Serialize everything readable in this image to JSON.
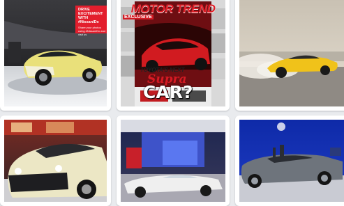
{
  "gallery": {
    "tiles": [
      {
        "alt": "Yellow concept car at auto show",
        "billboard_line1": "DRIVE EXCITEMENT",
        "billboard_line2": "WITH #NissanIDx",
        "billboard_small": "Share your photos using #NissanIDx and visit us"
      },
      {
        "alt": "Motor Trend magazine cover",
        "mag_title": "MOTOR TREND",
        "mag_exclusive": "EXCLUSIVE",
        "mag_headline": "TOYOTA'S NEXT",
        "mag_super": "Supra",
        "mag_car": "CAR?"
      },
      {
        "alt": "Yellow Corvette drifting with tire smoke"
      },
      {
        "alt": "Cream and black retro concept car on display"
      },
      {
        "alt": "White vintage concept roadster in showroom"
      },
      {
        "alt": "Gray convertible Mustang on stage"
      }
    ]
  }
}
